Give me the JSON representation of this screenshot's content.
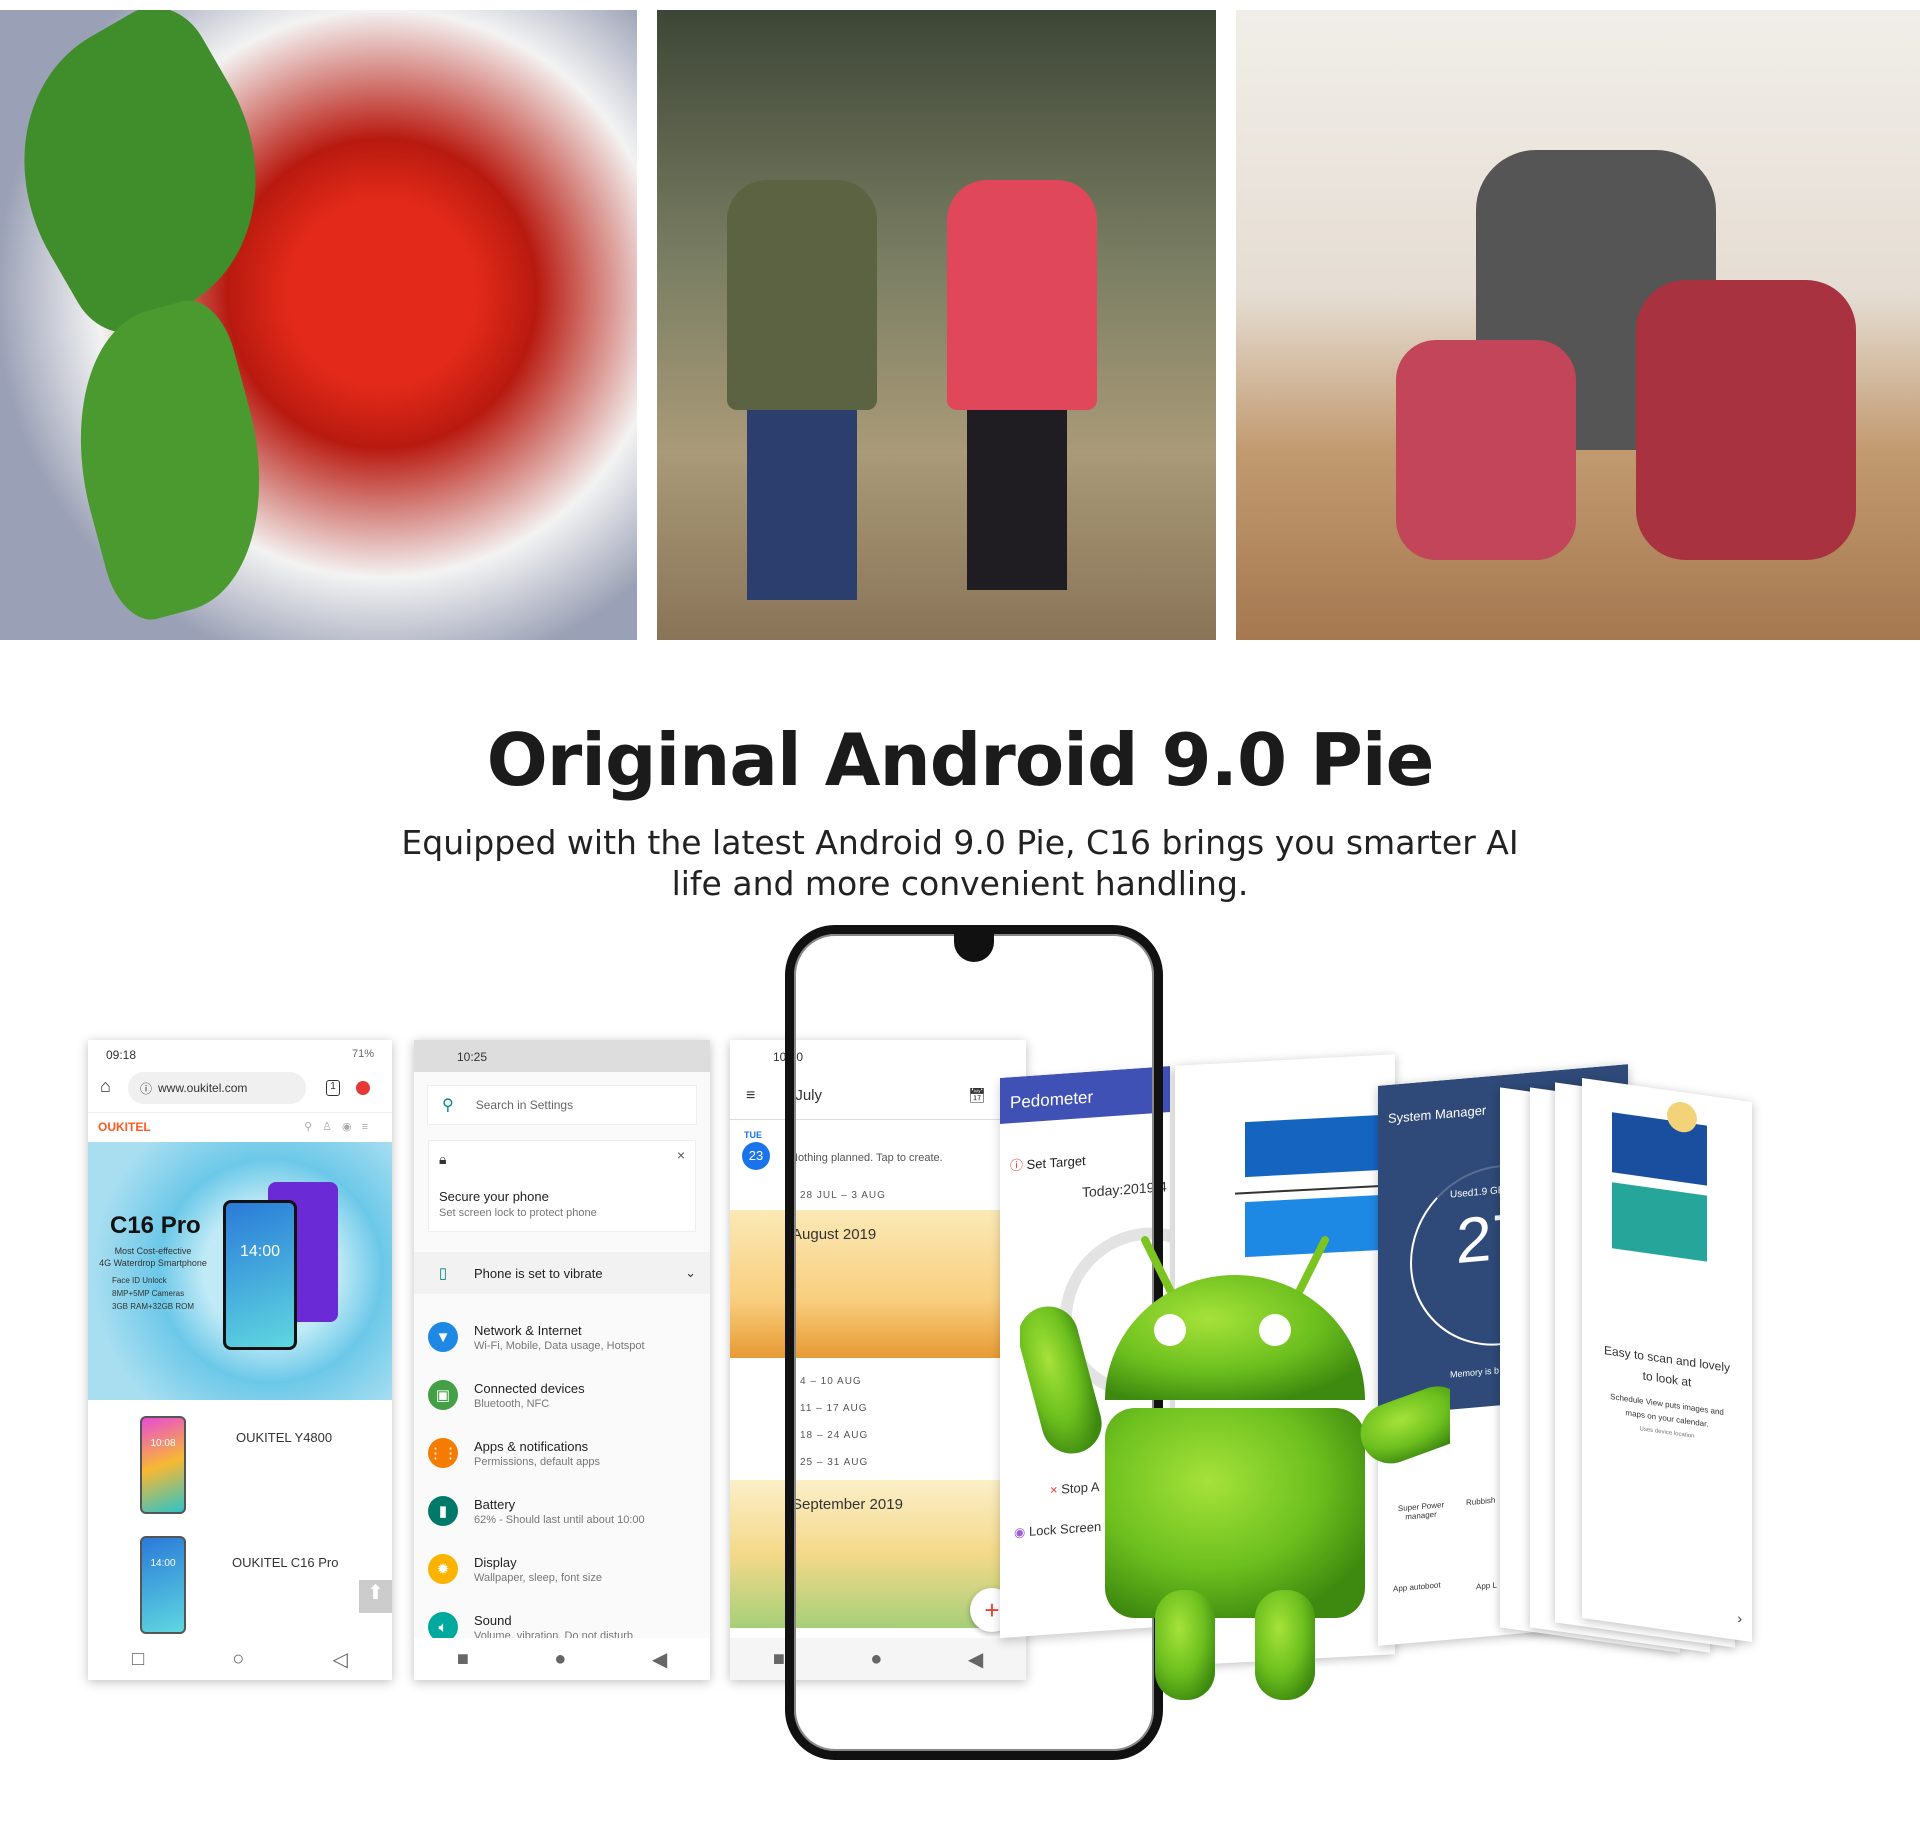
{
  "heading": {
    "title": "Original Android 9.0 Pie",
    "subtitle_line1": "Equipped with the latest Android 9.0 Pie, C16 brings you smarter AI",
    "subtitle_line2": "life and more convenient handling."
  },
  "browser": {
    "time": "09:18",
    "battery": "71%",
    "url": "www.oukitel.com",
    "tabs_count": "1",
    "logo": "OUKITEL",
    "banner": {
      "model": "C16 Pro",
      "tagline1": "Most Cost-effective",
      "tagline2": "4G Waterdrop Smartphone",
      "features": [
        "Face ID Unlock",
        "8MP+5MP Cameras",
        "3GB RAM+32GB ROM"
      ],
      "clock": "14:00"
    },
    "products": [
      {
        "name": "OUKITEL Y4800",
        "clock": "10:08"
      },
      {
        "name": "OUKITEL C16 Pro",
        "clock": "14:00"
      }
    ]
  },
  "settings": {
    "time": "10:25",
    "search_placeholder": "Search in Settings",
    "card": {
      "title": "Secure your phone",
      "subtitle": "Set screen lock to protect phone"
    },
    "vibrate": "Phone is set to vibrate",
    "items": [
      {
        "title": "Network & Internet",
        "subtitle": "Wi-Fi, Mobile, Data usage, Hotspot",
        "color": "#1e88e5",
        "icon": "wifi-icon"
      },
      {
        "title": "Connected devices",
        "subtitle": "Bluetooth, NFC",
        "color": "#43a047",
        "icon": "devices-icon"
      },
      {
        "title": "Apps & notifications",
        "subtitle": "Permissions, default apps",
        "color": "#f57c00",
        "icon": "apps-icon"
      },
      {
        "title": "Battery",
        "subtitle": "62% - Should last until about 10:00",
        "color": "#00796b",
        "icon": "battery-icon"
      },
      {
        "title": "Display",
        "subtitle": "Wallpaper, sleep, font size",
        "color": "#fbb300",
        "icon": "display-icon"
      },
      {
        "title": "Sound",
        "subtitle": "Volume, vibration, Do not disturb",
        "color": "#00a99d",
        "icon": "sound-icon"
      }
    ]
  },
  "calendar": {
    "time": "10:10",
    "month": "July",
    "day_name": "TUE",
    "day_num": "23",
    "empty": "Nothing planned. Tap to create.",
    "week1": "28 JUL – 3 AUG",
    "aug": "August 2019",
    "weeks": [
      "4 – 10 AUG",
      "11 – 17 AUG",
      "18 – 24 AUG",
      "25 – 31 AUG"
    ],
    "sep": "September 2019"
  },
  "pedometer": {
    "title": "Pedometer",
    "set_target": "Set Target",
    "today": "Today:2019-4",
    "stop": "Stop A",
    "lock": "Lock Screen"
  },
  "system_manager": {
    "title": "System Manager",
    "used": "Used1.9 GB",
    "big": "27",
    "memory": "Memory is b",
    "tools": [
      "Super Power manager",
      "Rubbish",
      "App autoboot",
      "App L"
    ]
  },
  "schedule": {
    "title_line1": "Easy to scan and lovely",
    "title_line2": "to look at",
    "desc_line1": "Schedule View puts images and",
    "desc_line2": "maps on your calendar.",
    "note": "Uses device location"
  },
  "colors": {
    "android_green": "#7cc520",
    "pedometer_blue": "#3f51b5",
    "system_manager_navy": "#2f4a78",
    "calendar_blue": "#1a73e8",
    "oukitel_orange": "#ff5a1f"
  }
}
